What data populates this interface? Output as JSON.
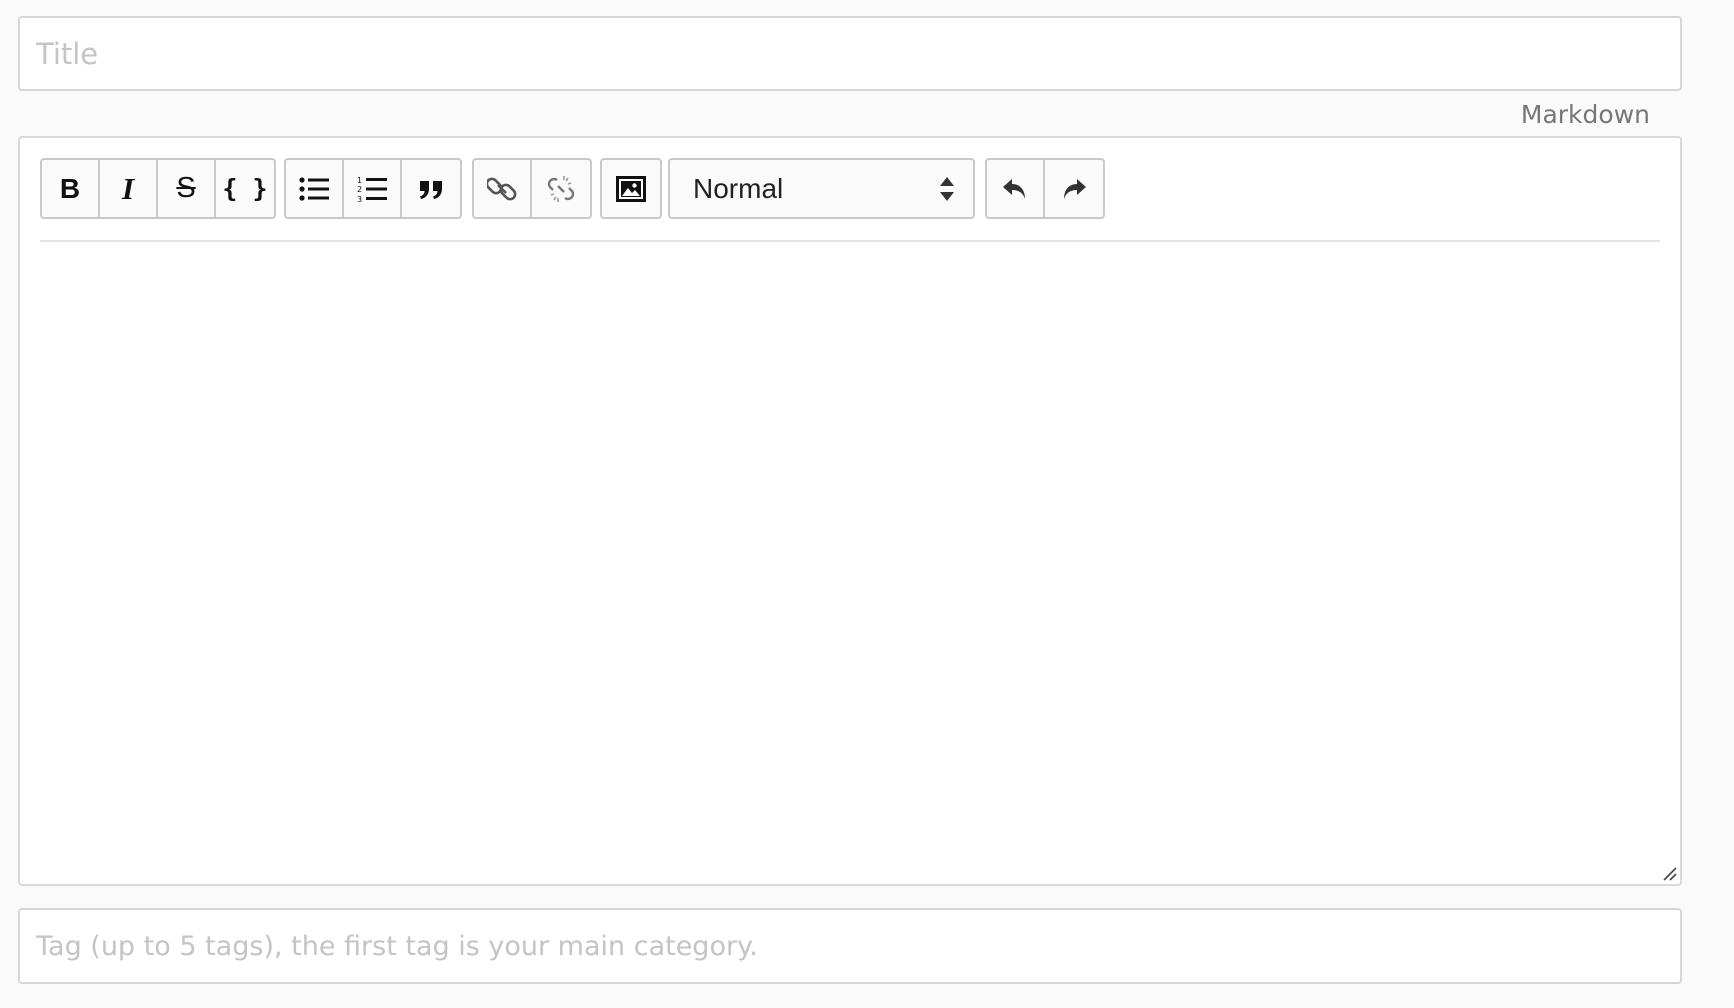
{
  "title_field": {
    "placeholder": "Title",
    "value": ""
  },
  "editor_mode_link": "Markdown",
  "toolbar": {
    "bold": "B",
    "italic": "I",
    "strikethrough": "S",
    "code": "{ }",
    "bullet_list_icon": "list-ul-icon",
    "numbered_list_icon": "list-ol-icon",
    "blockquote_icon": "quote-icon",
    "link_icon": "link-icon",
    "unlink_icon": "unlink-icon",
    "image_icon": "image-icon",
    "heading_select": {
      "selected": "Normal"
    },
    "undo_icon": "undo-icon",
    "redo_icon": "redo-icon"
  },
  "body": {
    "value": ""
  },
  "tags_field": {
    "placeholder": "Tag (up to 5 tags), the first tag is your main category.",
    "value": ""
  }
}
